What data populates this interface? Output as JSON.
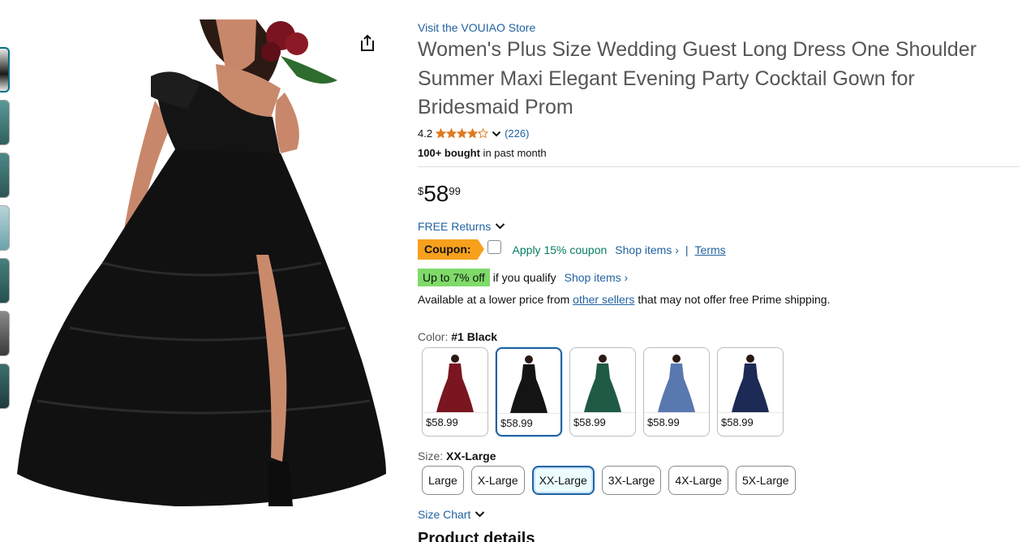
{
  "thumbnails": [
    {
      "name": "thumb-1",
      "active": true
    },
    {
      "name": "thumb-2"
    },
    {
      "name": "thumb-3"
    },
    {
      "name": "thumb-4"
    },
    {
      "name": "thumb-5"
    },
    {
      "name": "thumb-6"
    },
    {
      "name": "thumb-7"
    }
  ],
  "product": {
    "store_link": "Visit the VOUIAO Store",
    "title": "Women's Plus Size Wedding Guest Long Dress One Shoulder Summer Maxi Elegant Evening Party Cocktail Gown for Bridesmaid Prom",
    "rating_value": "4.2",
    "rating_stars": 4.2,
    "review_count": "(226)",
    "bought_bold": "100+ bought",
    "bought_rest": " in past month"
  },
  "price": {
    "symbol": "$",
    "whole": "58",
    "fraction": "99"
  },
  "returns": {
    "label": "FREE Returns"
  },
  "coupon": {
    "badge": "Coupon:",
    "text": "Apply 15% coupon",
    "shop_items": "Shop items ›",
    "separator": "|",
    "terms": "Terms"
  },
  "qualify": {
    "badge": "Up to 7% off",
    "text": "if you qualify",
    "shop_items": "Shop items ›"
  },
  "lower_price": {
    "before": "Available at a lower price from ",
    "link": "other sellers",
    "after": " that may not offer free Prime shipping."
  },
  "color": {
    "label": "Color: ",
    "selected": "#1 Black",
    "options": [
      {
        "price": "$58.99",
        "color": "#7a1620"
      },
      {
        "price": "$58.99",
        "color": "#141414",
        "selected": true
      },
      {
        "price": "$58.99",
        "color": "#1f5a45"
      },
      {
        "price": "$58.99",
        "color": "#5a78b0"
      },
      {
        "price": "$58.99",
        "color": "#1c2a55"
      }
    ]
  },
  "size": {
    "label": "Size: ",
    "selected": "XX-Large",
    "options": [
      "Large",
      "X-Large",
      "XX-Large",
      "3X-Large",
      "4X-Large",
      "5X-Large"
    ]
  },
  "size_chart": {
    "label": "Size Chart"
  },
  "details": {
    "heading": "Product details"
  },
  "colors": {
    "link": "#2162a1",
    "coupon_orange": "#f7a01c",
    "qualify_green": "#7fda69",
    "star": "#de7921"
  }
}
